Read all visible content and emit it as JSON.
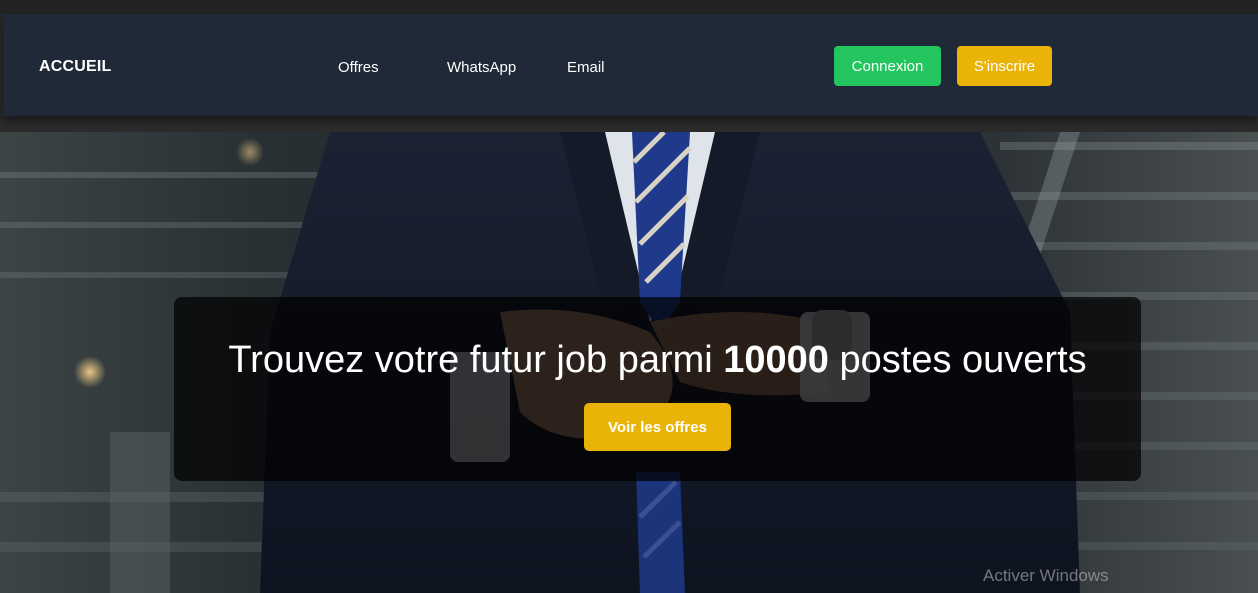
{
  "navbar": {
    "brand": "ACCUEIL",
    "links": [
      "Offres",
      "WhatsApp",
      "Email"
    ],
    "login_label": "Connexion",
    "signup_label": "S'inscrire",
    "colors": {
      "background": "#1f2937",
      "login": "#22c55e",
      "signup": "#eab308"
    }
  },
  "hero": {
    "headline_before": "Trouvez votre futur job parmi ",
    "headline_count": "10000",
    "headline_after": " postes ouverts",
    "cta_label": "Voir les offres",
    "image": "businessman-in-suit-photo"
  },
  "system": {
    "watermark": "Activer Windows"
  }
}
